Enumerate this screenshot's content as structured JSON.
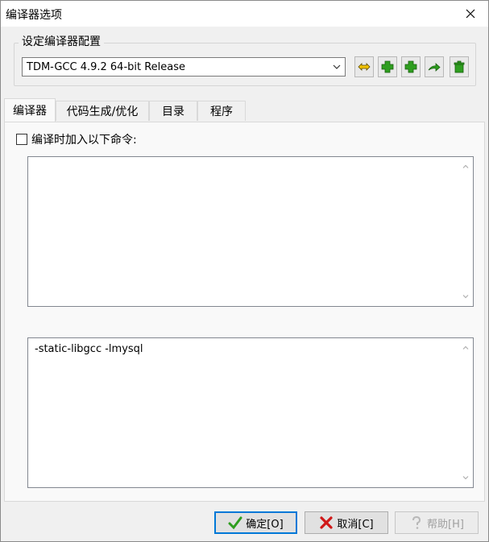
{
  "window": {
    "title": "编译器选项"
  },
  "config": {
    "group_label": "设定编译器配置",
    "selected_compiler": "TDM-GCC 4.9.2 64-bit Release"
  },
  "tabs": [
    {
      "label": "编译器"
    },
    {
      "label": "代码生成/优化"
    },
    {
      "label": "目录"
    },
    {
      "label": "程序"
    }
  ],
  "compiler": {
    "add_commands_label": "编译时加入以下命令:",
    "compile_commands": "",
    "linker_commands": "-static-libgcc -lmysql"
  },
  "buttons": {
    "ok": "确定[O]",
    "cancel": "取消[C]",
    "help": "帮助[H]"
  },
  "colors": {
    "accent": "#0078d7",
    "icon_green": "#2e9e1f",
    "icon_yellow": "#f2c200"
  }
}
